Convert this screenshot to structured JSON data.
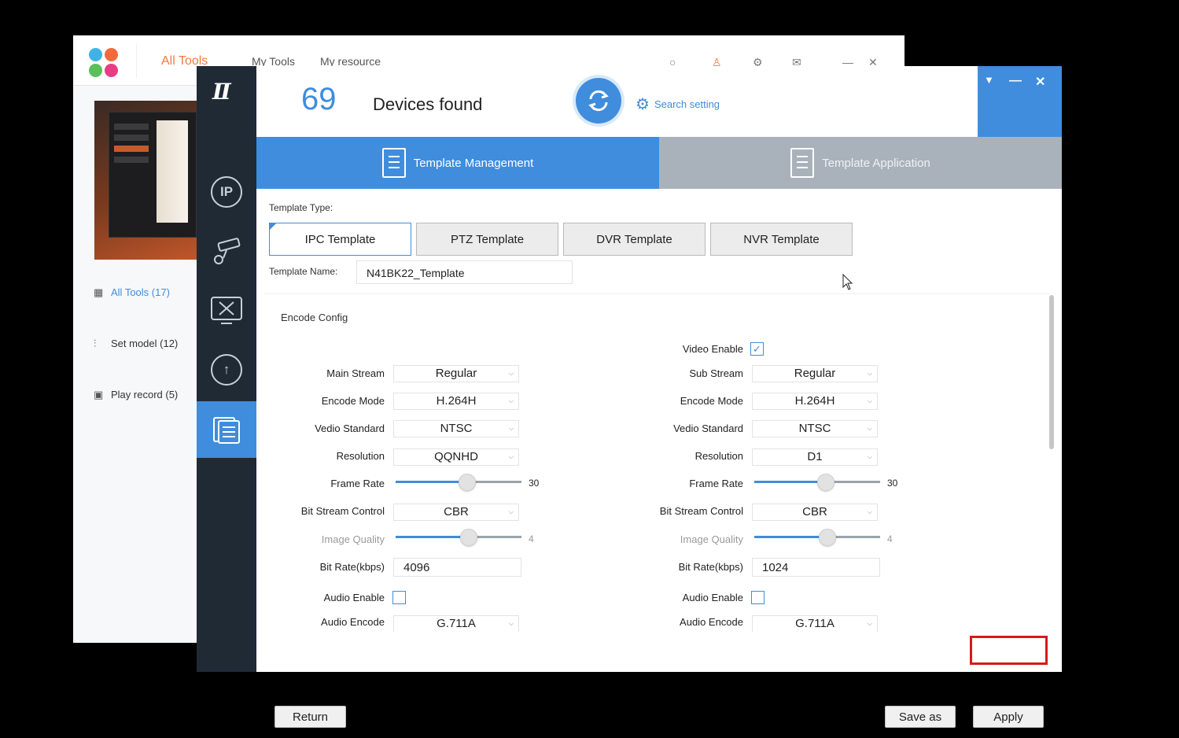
{
  "launcher": {
    "tabs": [
      "All Tools",
      "My Tools",
      "My resource"
    ],
    "sidebar": [
      {
        "label": "All Tools (17)",
        "icon": "grid-icon"
      },
      {
        "label": "Set model (12)",
        "icon": "sliders-icon"
      },
      {
        "label": "Play record (5)",
        "icon": "play-icon"
      }
    ],
    "colors": {
      "tab_active": "#f07b3f"
    }
  },
  "header": {
    "device_count": "69",
    "devices_label": "Devices found",
    "search_setting": "Search setting"
  },
  "tabs": {
    "management": "Template Management",
    "application": "Template Application"
  },
  "template": {
    "type_label": "Template Type:",
    "types": [
      "IPC Template",
      "PTZ Template",
      "DVR Template",
      "NVR Template"
    ],
    "name_label": "Template Name:",
    "name_value": "N41BK22_Template"
  },
  "encode": {
    "section_title": "Encode Config",
    "video_enable_label": "Video Enable",
    "video_enable": true,
    "main": {
      "stream_label": "Main Stream",
      "stream": "Regular",
      "encode_mode_label": "Encode Mode",
      "encode_mode": "H.264H",
      "video_standard_label": "Vedio Standard",
      "video_standard": "NTSC",
      "resolution_label": "Resolution",
      "resolution": "QQNHD",
      "frame_rate_label": "Frame Rate",
      "frame_rate": "30",
      "frame_rate_fraction": 0.57,
      "bitstream_label": "Bit Stream Control",
      "bitstream": "CBR",
      "image_quality_label": "Image Quality",
      "image_quality": "4",
      "image_quality_fraction": 0.58,
      "bitrate_label": "Bit Rate(kbps)",
      "bitrate": "4096",
      "audio_enable_label": "Audio Enable",
      "audio_enable": false,
      "audio_encode_label": "Audio Encode",
      "audio_encode": "G.711A"
    },
    "sub": {
      "stream_label": "Sub Stream",
      "stream": "Regular",
      "encode_mode_label": "Encode Mode",
      "encode_mode": "H.264H",
      "video_standard_label": "Vedio Standard",
      "video_standard": "NTSC",
      "resolution_label": "Resolution",
      "resolution": "D1",
      "frame_rate_label": "Frame Rate",
      "frame_rate": "30",
      "frame_rate_fraction": 0.57,
      "bitstream_label": "Bit Stream Control",
      "bitstream": "CBR",
      "image_quality_label": "Image Quality",
      "image_quality": "4",
      "image_quality_fraction": 0.58,
      "bitrate_label": "Bit Rate(kbps)",
      "bitrate": "1024",
      "audio_enable_label": "Audio Enable",
      "audio_enable": false,
      "audio_encode_label": "Audio Encode",
      "audio_encode": "G.711A"
    }
  },
  "footer": {
    "return": "Return",
    "save_as": "Save as",
    "apply": "Apply"
  },
  "colors": {
    "accent": "#3f8ddc",
    "nav_bg": "#1f2a35",
    "highlight": "#d61a1a"
  }
}
